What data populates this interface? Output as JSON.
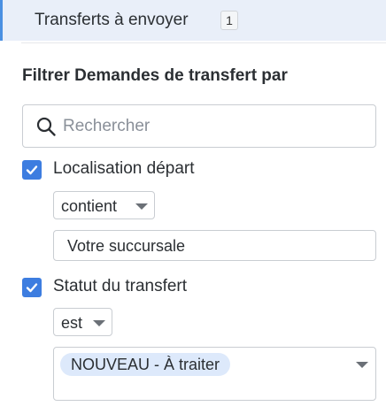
{
  "top_item": {
    "label": "Transferts à envoyer",
    "count": "1"
  },
  "filter": {
    "title": "Filtrer Demandes de transfert par",
    "search": {
      "placeholder": "Rechercher",
      "value": ""
    },
    "criteria": [
      {
        "label": "Localisation départ",
        "checked": true,
        "operator": "contient",
        "value": "Votre succursale"
      },
      {
        "label": "Statut du transfert",
        "checked": true,
        "operator": "est",
        "selected": [
          "NOUVEAU - À traiter"
        ]
      }
    ]
  },
  "colors": {
    "accent": "#3d7de0",
    "highlight_bg": "#e9eff9",
    "chip_bg": "#dde9fb"
  }
}
